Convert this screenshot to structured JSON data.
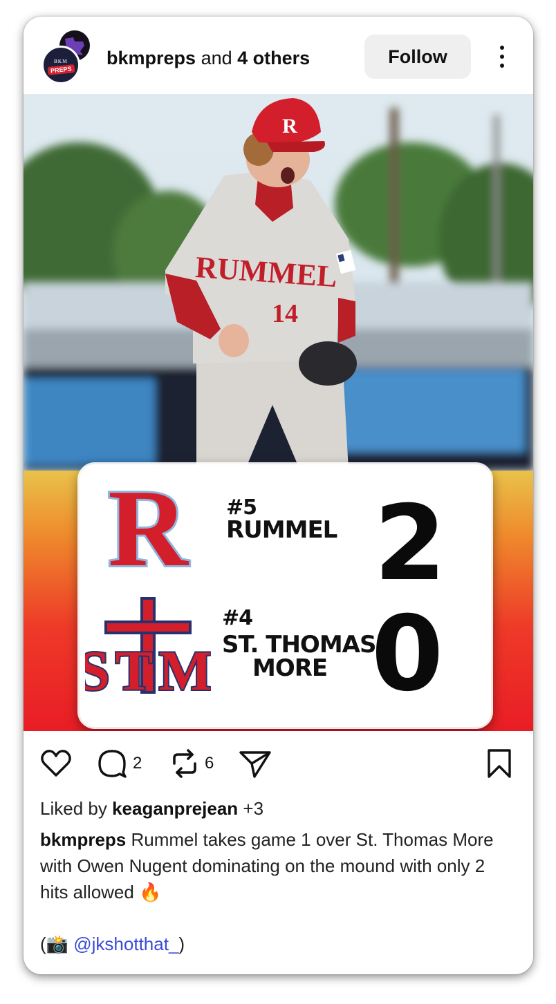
{
  "post": {
    "author": "bkmpreps",
    "coauthors_text": "and",
    "coauthors_count": "4 others",
    "follow_label": "Follow",
    "avatar_text_1": "BKM",
    "avatar_text_2": "PREPS"
  },
  "photo": {
    "cap_letter": "R",
    "jersey_text": "RUMMEL",
    "jersey_number": "14"
  },
  "scoreboard": {
    "home": {
      "rank": "#5",
      "name": "RUMMEL",
      "score": "2",
      "logo_letter": "R"
    },
    "away": {
      "rank": "#4",
      "name_line1": "ST. THOMAS",
      "name_line2": "MORE",
      "score": "0",
      "logo_letters": "STM"
    }
  },
  "actions": {
    "comments_count": "2",
    "reposts_count": "6"
  },
  "likes": {
    "prefix": "Liked by",
    "user": "keaganprejean",
    "suffix": "+3"
  },
  "caption": {
    "author": "bkmpreps",
    "text": "Rummel takes game 1 over St. Thomas More with Owen Nugent dominating on the mound with only 2 hits allowed 🔥"
  },
  "credit": {
    "open": "(📸 ",
    "handle": "@jkshotthat_",
    "close": ")"
  },
  "colors": {
    "rummel_red": "#d31f2b",
    "rummel_blue": "#8fb4de",
    "stm_navy": "#26316f",
    "link_blue": "#3b4bd8"
  }
}
